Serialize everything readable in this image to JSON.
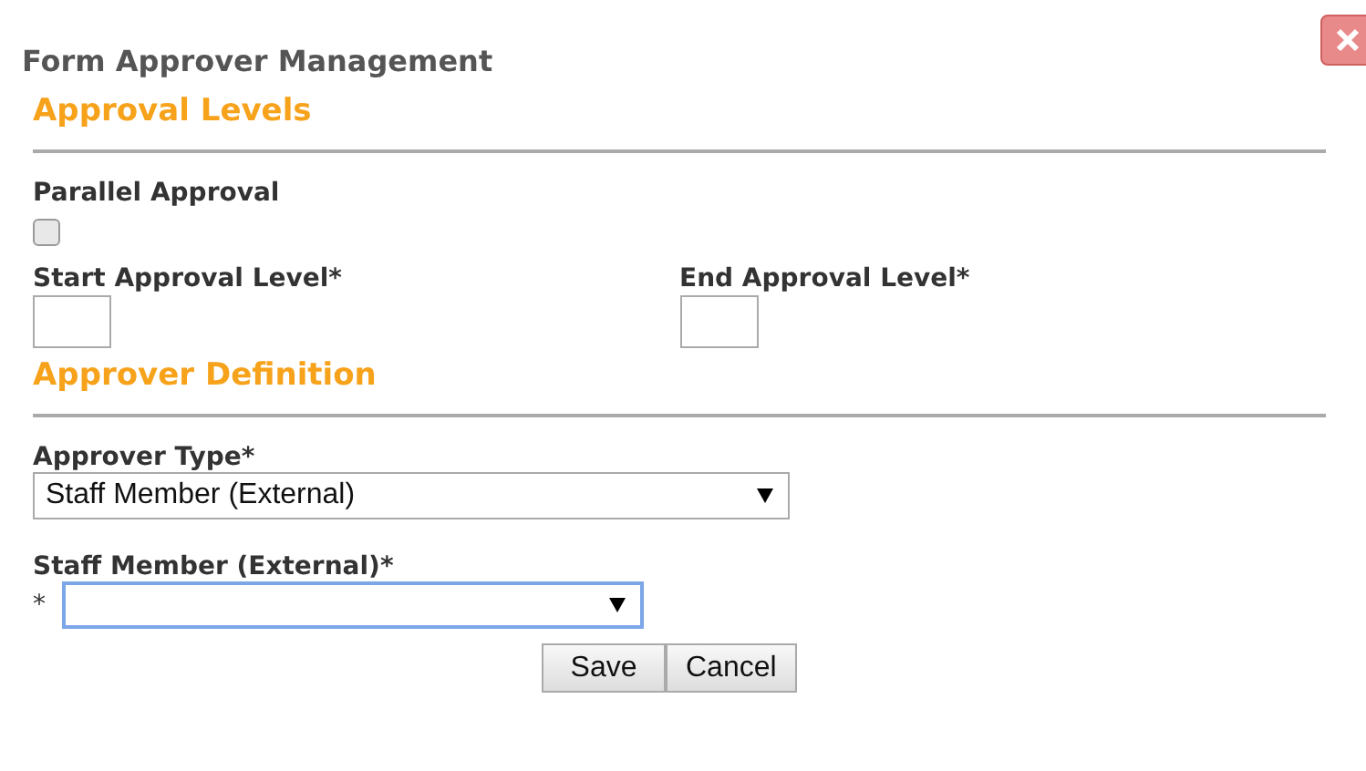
{
  "dialog": {
    "title": "Form Approver Management"
  },
  "sections": [
    {
      "heading": "Approval Levels",
      "fields": [
        {
          "kind": "checkbox",
          "label": "Parallel Approval",
          "checked": false
        },
        {
          "kind": "pair",
          "items": [
            {
              "label": "Start Approval Level*"
            },
            {
              "label": "End Approval Level*"
            }
          ]
        }
      ]
    },
    {
      "heading": "Approver Definition",
      "fields": [
        {
          "kind": "select",
          "label": "Approver Type*",
          "value": "Staff Member (External)",
          "focused": false
        },
        {
          "kind": "select",
          "label": "Staff Member (External)*",
          "prefix": "*",
          "focused": true
        }
      ]
    }
  ],
  "buttons": [
    "Save",
    "Cancel"
  ]
}
